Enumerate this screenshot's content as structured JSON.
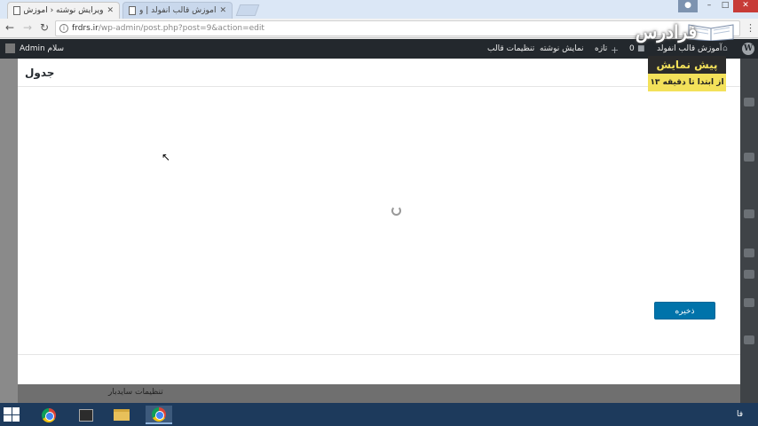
{
  "browser": {
    "tabs": [
      {
        "title": "ویرایش نوشته ‹ آموزش قا",
        "active": true
      },
      {
        "title": "آموزش قالب انفولد | ویرا",
        "active": false
      }
    ],
    "close_glyph": "✕",
    "url_host": "frdrs.ir",
    "url_path": "/wp-admin/post.php?post=9&action=edit",
    "icons": [
      "doc-icon",
      "user-icon",
      "minimize-icon",
      "maximize-icon",
      "close-icon",
      "back-icon",
      "forward-icon",
      "reload-icon",
      "info-icon",
      "menu-icon"
    ]
  },
  "admin_bar": {
    "site_name": "آموزش قالب انفولد",
    "comment_count": "0",
    "new_label": "تازه",
    "view_post": "نمایش نوشته",
    "theme_settings": "تنظیمات قالب",
    "howdy": "سلام Admin"
  },
  "modal": {
    "title": "جدول",
    "save_label": "ذخیره"
  },
  "background": {
    "settings_label": "تنظیمات سایدبار"
  },
  "promo": {
    "logo": "فرادرس",
    "headline": "پیش نمایش",
    "subline": "از ابتدا تا دقیقه ۱۳"
  },
  "taskbar": {
    "lang": "فا",
    "apps": [
      "chrome-icon",
      "tool-icon",
      "folder-icon",
      "chrome-icon"
    ]
  },
  "colors": {
    "admin_bar": "#23282d",
    "primary_button": "#0073aa",
    "promo_yellow": "#f3e15a",
    "taskbar": "#1d3a5c"
  }
}
